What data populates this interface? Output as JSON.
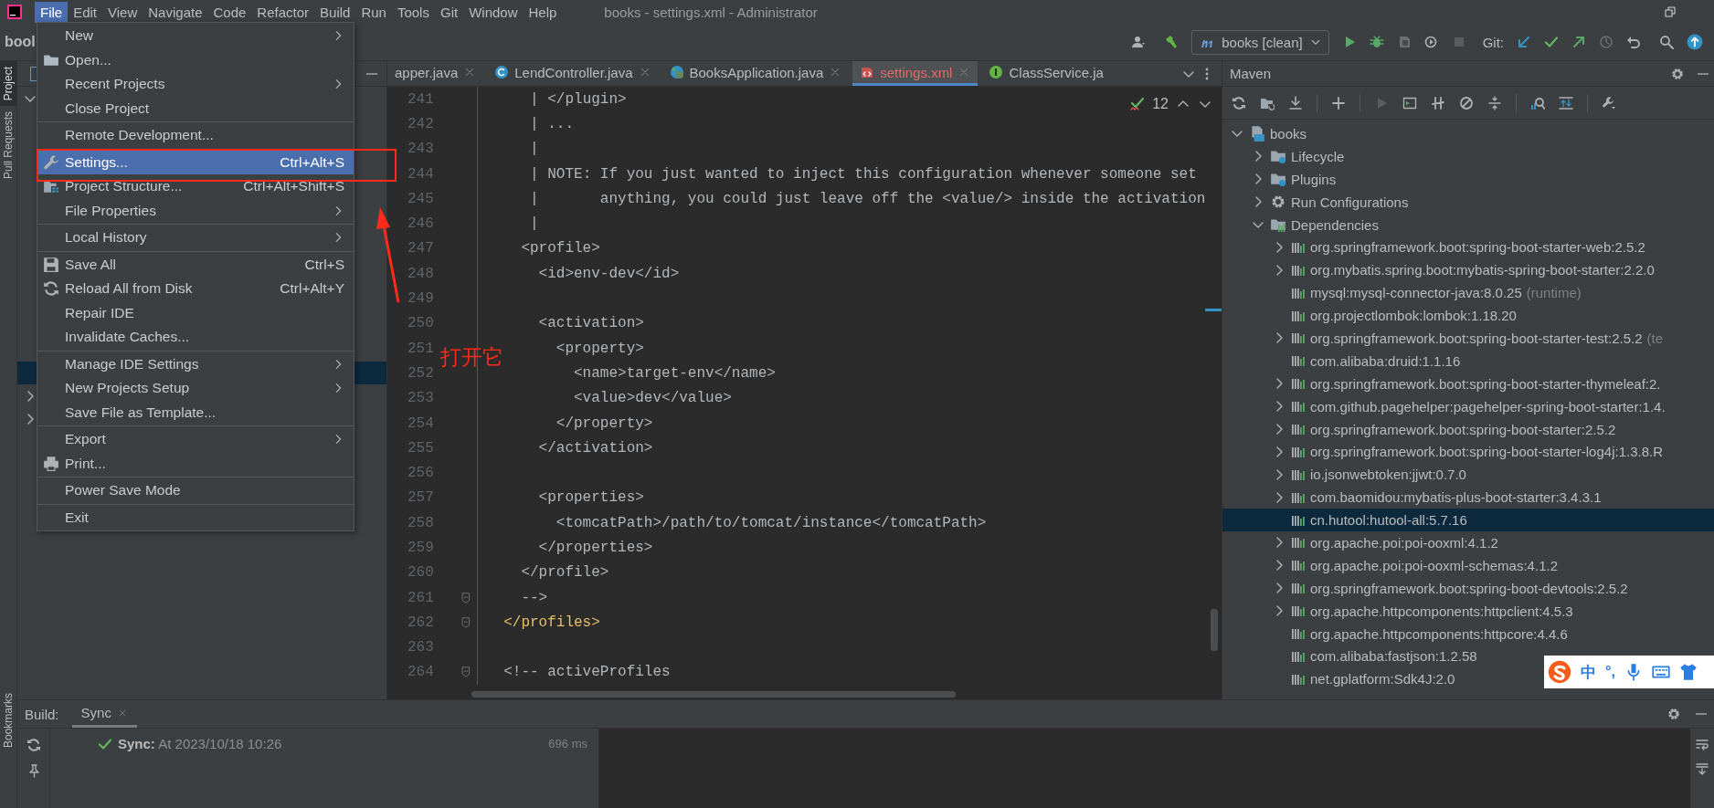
{
  "menubar": {
    "items": [
      {
        "label": "File",
        "selected": true
      },
      {
        "label": "Edit",
        "selected": false
      },
      {
        "label": "View",
        "selected": false
      },
      {
        "label": "Navigate",
        "selected": false
      },
      {
        "label": "Code",
        "selected": false
      },
      {
        "label": "Refactor",
        "selected": false
      },
      {
        "label": "Build",
        "selected": false
      },
      {
        "label": "Run",
        "selected": false
      },
      {
        "label": "Tools",
        "selected": false
      },
      {
        "label": "Git",
        "selected": false
      },
      {
        "label": "Window",
        "selected": false
      },
      {
        "label": "Help",
        "selected": false
      }
    ],
    "title": "books - settings.xml - Administrator"
  },
  "navbar": {
    "breadcrumb": "bool",
    "run_config": "books [clean]",
    "git_label": "Git:"
  },
  "sidebar": {
    "tabs": [
      {
        "label": "Project",
        "selected": true
      },
      {
        "label": "Pull Requests",
        "selected": false
      }
    ],
    "bottom_tabs": [
      {
        "label": "Bookmarks",
        "selected": false
      }
    ]
  },
  "file_menu": {
    "groups": [
      {
        "items": [
          {
            "label": "New",
            "submenu": true
          },
          {
            "label": "Open...",
            "kind": "folder"
          },
          {
            "label": "Recent Projects",
            "submenu": true
          },
          {
            "label": "Close Project"
          }
        ]
      },
      {
        "items": [
          {
            "label": "Remote Development..."
          }
        ]
      },
      {
        "items": [
          {
            "label": "Settings...",
            "kind": "wrench",
            "shortcut": "Ctrl+Alt+S",
            "selected": true
          },
          {
            "label": "Project Structure...",
            "kind": "structure",
            "shortcut": "Ctrl+Alt+Shift+S"
          },
          {
            "label": "File Properties",
            "submenu": true
          }
        ]
      },
      {
        "items": [
          {
            "label": "Local History",
            "submenu": true
          }
        ]
      },
      {
        "items": [
          {
            "label": "Save All",
            "kind": "save",
            "shortcut": "Ctrl+S"
          },
          {
            "label": "Reload All from Disk",
            "kind": "reload",
            "shortcut": "Ctrl+Alt+Y"
          },
          {
            "label": "Repair IDE"
          },
          {
            "label": "Invalidate Caches..."
          }
        ]
      },
      {
        "items": [
          {
            "label": "Manage IDE Settings",
            "submenu": true
          },
          {
            "label": "New Projects Setup",
            "submenu": true
          },
          {
            "label": "Save File as Template..."
          }
        ]
      },
      {
        "items": [
          {
            "label": "Export",
            "submenu": true
          },
          {
            "label": "Print...",
            "kind": "print"
          }
        ]
      },
      {
        "items": [
          {
            "label": "Power Save Mode"
          }
        ]
      },
      {
        "items": [
          {
            "label": "Exit"
          }
        ]
      }
    ]
  },
  "editor": {
    "tabs": [
      {
        "label": "apper.java",
        "selected": false,
        "error": false
      },
      {
        "label": "LendController.java",
        "kind": "class",
        "selected": false,
        "error": false
      },
      {
        "label": "BooksApplication.java",
        "kind": "spring",
        "selected": false,
        "error": false
      },
      {
        "label": "settings.xml",
        "kind": "xml",
        "selected": true,
        "error": true
      },
      {
        "label": "ClassService.ja",
        "kind": "interface",
        "selected": false,
        "error": false
      }
    ],
    "inspection_count": "12",
    "lines": [
      {
        "n": "241",
        "kind": "comment",
        "text": "     | </plugin>"
      },
      {
        "n": "242",
        "kind": "comment",
        "text": "     | ..."
      },
      {
        "n": "243",
        "kind": "comment",
        "text": "     |"
      },
      {
        "n": "244",
        "kind": "comment",
        "text": "     | NOTE: If you just wanted to inject this configuration whenever someone set"
      },
      {
        "n": "245",
        "kind": "comment",
        "text": "     |       anything, you could just leave off the <value/> inside the activation"
      },
      {
        "n": "246",
        "kind": "comment",
        "text": "     |"
      },
      {
        "n": "247",
        "kind": "comment",
        "text": "    <profile>"
      },
      {
        "n": "248",
        "kind": "comment",
        "text": "      <id>env-dev</id>"
      },
      {
        "n": "249"
      },
      {
        "n": "250",
        "kind": "comment",
        "text": "      <activation>"
      },
      {
        "n": "251",
        "kind": "comment",
        "text": "        <property>"
      },
      {
        "n": "252",
        "kind": "comment",
        "text": "          <name>target-env</name>"
      },
      {
        "n": "253",
        "kind": "comment",
        "text": "          <value>dev</value>"
      },
      {
        "n": "254",
        "kind": "comment",
        "text": "        </property>"
      },
      {
        "n": "255",
        "kind": "comment",
        "text": "      </activation>"
      },
      {
        "n": "256"
      },
      {
        "n": "257",
        "kind": "comment",
        "text": "      <properties>"
      },
      {
        "n": "258",
        "kind": "comment",
        "text": "        <tomcatPath>/path/to/tomcat/instance</tomcatPath>"
      },
      {
        "n": "259",
        "kind": "comment",
        "text": "      </properties>"
      },
      {
        "n": "260",
        "kind": "comment",
        "text": "    </profile>"
      },
      {
        "n": "261",
        "kind": "comment",
        "text": "    -->",
        "fold": true
      },
      {
        "n": "262",
        "kind": "tag",
        "text": "  </profiles>",
        "fold": true
      },
      {
        "n": "263"
      },
      {
        "n": "264",
        "kind": "comment",
        "text": "  <!-- activeProfiles",
        "fold": true
      }
    ]
  },
  "maven": {
    "title": "Maven",
    "tree": [
      {
        "label": "books",
        "kind": "project",
        "expanded": true,
        "children": [
          {
            "label": "Lifecycle",
            "kind": "lifecycle",
            "expanded": false
          },
          {
            "label": "Plugins",
            "kind": "lifecycle",
            "expanded": false
          },
          {
            "label": "Run Configurations",
            "kind": "gear",
            "expanded": false
          },
          {
            "label": "Dependencies",
            "kind": "deps",
            "expanded": true,
            "children": [
              {
                "label": "org.springframework.boot:spring-boot-starter-web:2.5.2",
                "expandable": true,
                "selected": false
              },
              {
                "label": "org.mybatis.spring.boot:mybatis-spring-boot-starter:2.2.0",
                "expandable": true,
                "selected": false
              },
              {
                "label": "mysql:mysql-connector-java:8.0.25",
                "scope": "(runtime)",
                "expandable": false,
                "selected": false
              },
              {
                "label": "org.projectlombok:lombok:1.18.20",
                "expandable": false,
                "selected": false
              },
              {
                "label": "org.springframework.boot:spring-boot-starter-test:2.5.2",
                "scope": "(te",
                "expandable": true,
                "selected": false
              },
              {
                "label": "com.alibaba:druid:1.1.16",
                "expandable": false,
                "selected": false
              },
              {
                "label": "org.springframework.boot:spring-boot-starter-thymeleaf:2.",
                "expandable": true,
                "selected": false
              },
              {
                "label": "com.github.pagehelper:pagehelper-spring-boot-starter:1.4.",
                "expandable": true,
                "selected": false
              },
              {
                "label": "org.springframework.boot:spring-boot-starter:2.5.2",
                "expandable": true,
                "selected": false
              },
              {
                "label": "org.springframework.boot:spring-boot-starter-log4j:1.3.8.R",
                "expandable": true,
                "selected": false
              },
              {
                "label": "io.jsonwebtoken:jjwt:0.7.0",
                "expandable": true,
                "selected": false
              },
              {
                "label": "com.baomidou:mybatis-plus-boot-starter:3.4.3.1",
                "expandable": true,
                "selected": false
              },
              {
                "label": "cn.hutool:hutool-all:5.7.16",
                "expandable": false,
                "selected": true
              },
              {
                "label": "org.apache.poi:poi-ooxml:4.1.2",
                "expandable": true,
                "selected": false
              },
              {
                "label": "org.apache.poi:poi-ooxml-schemas:4.1.2",
                "expandable": true,
                "selected": false
              },
              {
                "label": "org.springframework.boot:spring-boot-devtools:2.5.2",
                "expandable": true,
                "selected": false
              },
              {
                "label": "org.apache.httpcomponents:httpclient:4.5.3",
                "expandable": true,
                "selected": false
              },
              {
                "label": "org.apache.httpcomponents:httpcore:4.4.6",
                "expandable": false,
                "selected": false
              },
              {
                "label": "com.alibaba:fastjson:1.2.58",
                "expandable": false,
                "selected": false
              },
              {
                "label": "net.gplatform:Sdk4J:2.0",
                "expandable": false,
                "selected": false
              }
            ]
          }
        ]
      }
    ]
  },
  "build": {
    "label": "Build:",
    "tabs": [
      {
        "label": "Sync",
        "selected": true
      }
    ],
    "event": "**Sync:** At 2023/10/18 10:26",
    "time": "696 ms"
  },
  "annotation": {
    "text": "打开它"
  },
  "ime": {
    "mode": "中",
    "punctuation": "°,"
  }
}
